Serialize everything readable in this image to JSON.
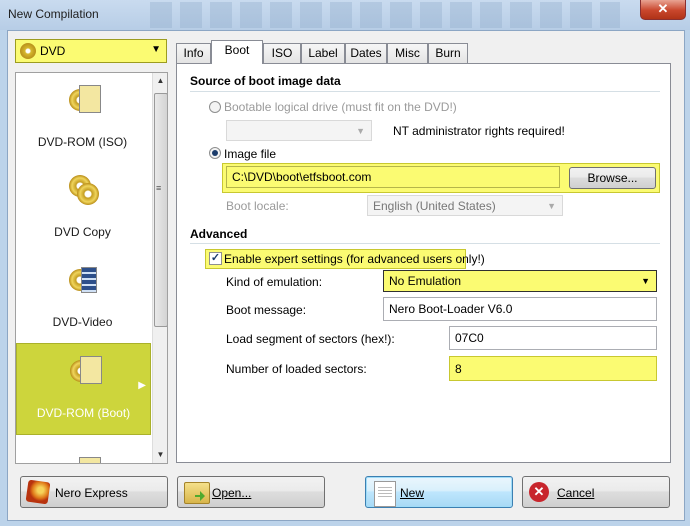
{
  "window": {
    "title": "New Compilation",
    "close_glyph": "✕"
  },
  "left": {
    "combo_value": "DVD",
    "categories": [
      {
        "label": "DVD-ROM (ISO)",
        "icon": "dvd-rom-iso-icon"
      },
      {
        "label": "DVD Copy",
        "icon": "dvd-copy-icon"
      },
      {
        "label": "DVD-Video",
        "icon": "dvd-video-icon"
      },
      {
        "label": "DVD-ROM (Boot)",
        "icon": "dvd-rom-boot-icon",
        "selected": true
      }
    ],
    "scroll_grip": "≡"
  },
  "tabs": [
    "Info",
    "Boot",
    "ISO",
    "Label",
    "Dates",
    "Misc",
    "Burn"
  ],
  "active_tab": "Boot",
  "boot": {
    "source_heading": "Source of boot image data",
    "bootable_drive_label": "Bootable logical drive (must fit on the DVD!)",
    "nt_note": "NT administrator rights required!",
    "image_file_label": "Image file",
    "image_file_value": "C:\\DVD\\boot\\etfsboot.com",
    "browse_label": "Browse...",
    "boot_locale_label": "Boot locale:",
    "boot_locale_value": "English (United States)",
    "advanced_heading": "Advanced",
    "expert_label": "Enable expert settings (for advanced users only!)",
    "expert_checked": true,
    "emulation_label": "Kind of emulation:",
    "emulation_value": "No Emulation",
    "boot_message_label": "Boot message:",
    "boot_message_value": "Nero Boot-Loader V6.0",
    "load_segment_label": "Load segment of sectors (hex!):",
    "load_segment_value": "07C0",
    "sectors_label": "Number of loaded sectors:",
    "sectors_value": "8"
  },
  "footer": {
    "nero_express": "Nero Express",
    "open": "Open...",
    "new": "New",
    "cancel": "Cancel"
  },
  "colors": {
    "highlight": "#fbfb72",
    "selected_category": "#cdd53c",
    "cancel_icon": "#c8252c"
  }
}
